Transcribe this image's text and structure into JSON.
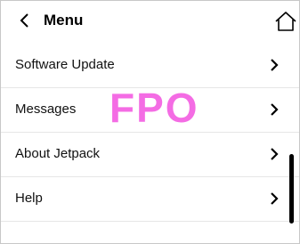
{
  "header": {
    "title": "Menu",
    "back_icon": "chevron-left-icon",
    "home_icon": "home-icon"
  },
  "menu": {
    "items": [
      {
        "label": "Software Update",
        "icon": "chevron-right-icon"
      },
      {
        "label": "Messages",
        "icon": "chevron-right-icon"
      },
      {
        "label": "About Jetpack",
        "icon": "chevron-right-icon"
      },
      {
        "label": "Help",
        "icon": "chevron-right-icon"
      }
    ]
  },
  "overlay": {
    "text": "FPO",
    "color": "#f46ce4"
  },
  "colors": {
    "accent_overlay": "#f46ce4",
    "text": "#111111",
    "divider": "#e6e6e6"
  }
}
